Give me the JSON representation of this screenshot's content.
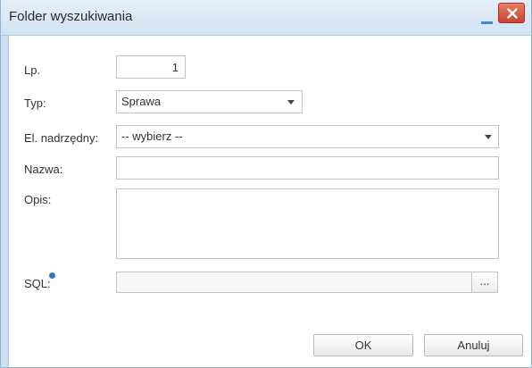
{
  "window": {
    "title": "Folder wyszukiwania"
  },
  "form": {
    "lp": {
      "label": "Lp.",
      "value": "1"
    },
    "typ": {
      "label": "Typ:",
      "value": "Sprawa"
    },
    "parent": {
      "label": "El. nadrzędny:",
      "value": "-- wybierz --"
    },
    "nazwa": {
      "label": "Nazwa:",
      "value": ""
    },
    "opis": {
      "label": "Opis:",
      "value": ""
    },
    "sql": {
      "label": "SQL:",
      "value": "",
      "browse_label": "..."
    }
  },
  "buttons": {
    "ok": "OK",
    "cancel": "Anuluj"
  },
  "colors": {
    "titlebar": "#d3e3f3",
    "close": "#c7462e",
    "minimize": "#3a8bd2",
    "info": "#3a74c4"
  },
  "icons": [
    "minimize-icon",
    "close-icon",
    "chevron-down-icon",
    "info-icon"
  ]
}
